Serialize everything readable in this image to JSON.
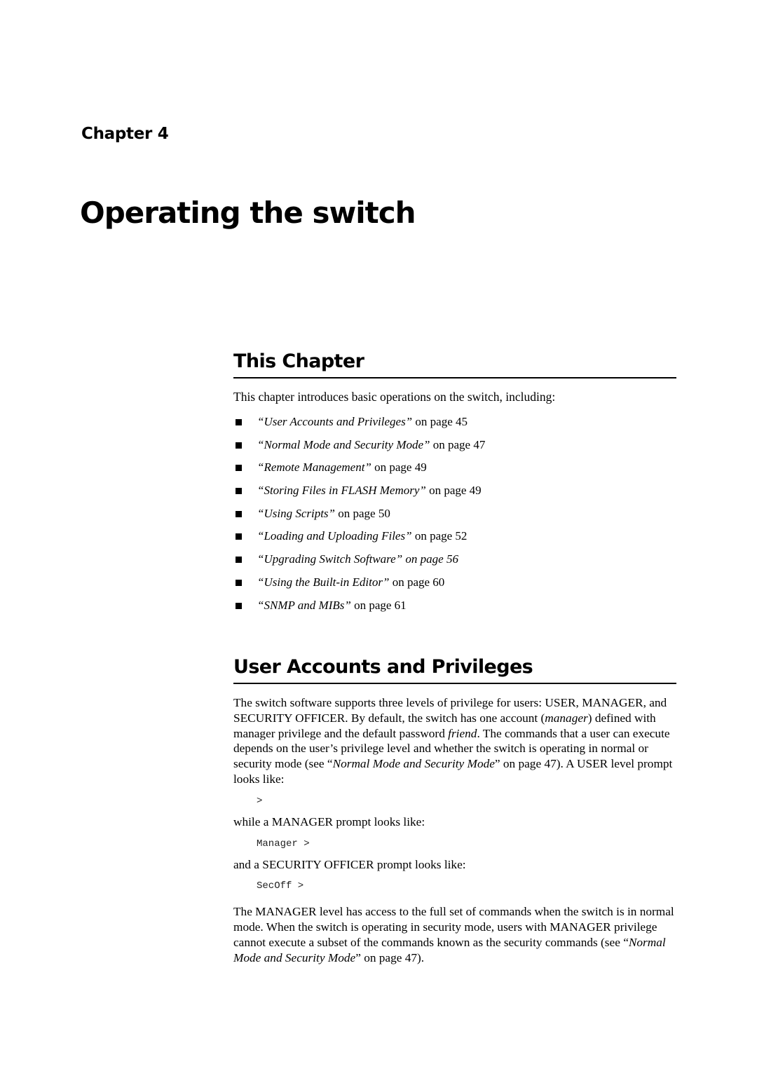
{
  "chapter": {
    "label": "Chapter 4",
    "title": "Operating the switch"
  },
  "this_chapter": {
    "heading": "This Chapter",
    "intro": "This chapter introduces basic operations on the switch, including:",
    "items": [
      {
        "title": "User Accounts and Privileges",
        "suffix": " on page 45",
        "suffix_italic": false
      },
      {
        "title": "Normal Mode and Security Mode",
        "suffix": " on page 47",
        "suffix_italic": false
      },
      {
        "title": "Remote Management",
        "suffix": " on page 49",
        "suffix_italic": false
      },
      {
        "title": "Storing Files in FLASH Memory",
        "suffix": " on page 49",
        "suffix_italic": false
      },
      {
        "title": "Using Scripts",
        "suffix": " on page 50",
        "suffix_italic": false
      },
      {
        "title": "Loading and Uploading Files",
        "suffix": " on page 52",
        "suffix_italic": false
      },
      {
        "title": "Upgrading Switch Software",
        "suffix": " on page 56",
        "suffix_italic": true
      },
      {
        "title": "Using the Built-in Editor",
        "suffix": " on page 60",
        "suffix_italic": false
      },
      {
        "title": "SNMP and MIBs",
        "suffix": " on page 61",
        "suffix_italic": false
      }
    ]
  },
  "user_accounts": {
    "heading": "User Accounts and Privileges",
    "para1": {
      "t1": "The switch software supports three levels of privilege for users: USER, MANAGER, and SECURITY OFFICER. By default, the switch has one account (",
      "i1": "manager",
      "t2": ") defined with manager privilege and the default password ",
      "i2": "friend",
      "t3": ". The commands that a user can execute depends on the user’s privilege level and whether the switch is operating in normal or security mode (see “",
      "i3": "Normal Mode and Security Mode",
      "t4": "” on page 47). A USER level prompt looks like:"
    },
    "prompt_user": ">",
    "line_manager": "while a MANAGER prompt looks like:",
    "prompt_manager": "Manager >",
    "line_secoff": "and a SECURITY OFFICER prompt looks like:",
    "prompt_secoff": "SecOff >",
    "para2": {
      "t1": "The MANAGER level has access to the full set of commands when the switch is in normal mode. When the switch is operating in security mode, users with MANAGER privilege cannot execute a subset of the commands known as the security commands (see “",
      "i1": "Normal Mode and Security Mode",
      "t2": "” on page 47)."
    }
  }
}
